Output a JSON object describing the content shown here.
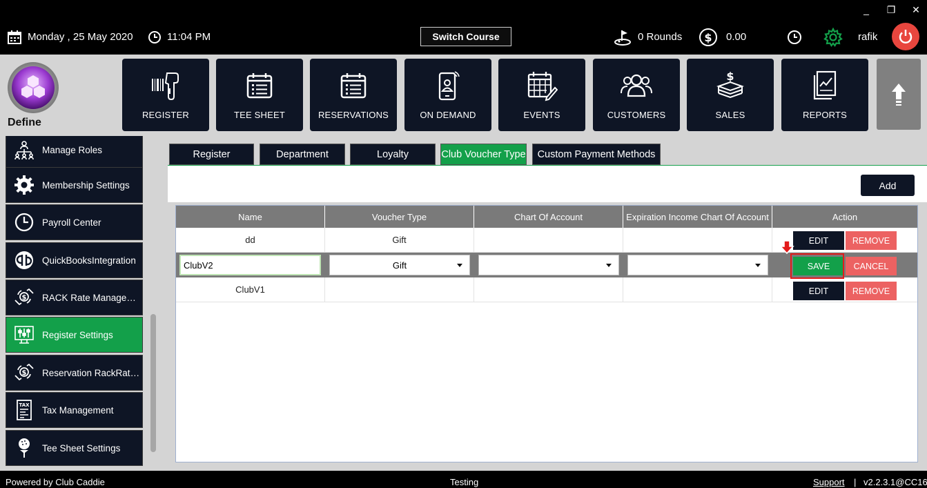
{
  "window": {
    "minimize": "_",
    "restore": "❐",
    "close": "✕"
  },
  "topbar": {
    "date": "Monday ,  25 May 2020",
    "time": "11:04 PM",
    "switch_course": "Switch Course",
    "rounds": "0 Rounds",
    "amount": "0.00",
    "username": "rafik"
  },
  "logo": {
    "label": "Define"
  },
  "nav": [
    {
      "label": "REGISTER",
      "icon": "barcode-scanner-icon"
    },
    {
      "label": "TEE SHEET",
      "icon": "calendar-list-icon"
    },
    {
      "label": "RESERVATIONS",
      "icon": "calendar-list-icon"
    },
    {
      "label": "ON DEMAND",
      "icon": "mobile-user-icon"
    },
    {
      "label": "EVENTS",
      "icon": "calendar-edit-icon"
    },
    {
      "label": "CUSTOMERS",
      "icon": "users-icon"
    },
    {
      "label": "SALES",
      "icon": "money-stack-icon"
    },
    {
      "label": "REPORTS",
      "icon": "report-chart-icon"
    }
  ],
  "sidebar": {
    "items": [
      {
        "label": "Manage Roles",
        "icon": "org-chart-icon"
      },
      {
        "label": "Membership Settings",
        "icon": "gear-icon"
      },
      {
        "label": "Payroll Center",
        "icon": "clock-icon"
      },
      {
        "label": "QuickBooksIntegration",
        "icon": "quickbooks-icon"
      },
      {
        "label": "RACK Rate Manageme...",
        "icon": "hand-money-icon"
      },
      {
        "label": "Register Settings",
        "icon": "register-settings-icon",
        "active": true
      },
      {
        "label": "Reservation RackRate...",
        "icon": "hand-money-icon"
      },
      {
        "label": "Tax Management",
        "icon": "tax-doc-icon"
      },
      {
        "label": "Tee Sheet Settings",
        "icon": "golf-ball-tee-icon"
      }
    ]
  },
  "tabs": [
    {
      "label": "Register"
    },
    {
      "label": "Department"
    },
    {
      "label": "Loyalty"
    },
    {
      "label": "Club Voucher Type",
      "active": true
    },
    {
      "label": "Custom Payment Methods"
    }
  ],
  "toolbar": {
    "add_label": "Add"
  },
  "grid": {
    "columns": [
      "Name",
      "Voucher Type",
      "Chart Of Account",
      "Expiration Income Chart Of Account",
      "Action"
    ],
    "rows": [
      {
        "name": "dd",
        "voucher_type": "Gift",
        "chart_of_account": "",
        "expiration_account": "",
        "edit": "EDIT",
        "remove": "REMOVE"
      },
      {
        "name": "ClubV1",
        "voucher_type": "",
        "chart_of_account": "",
        "expiration_account": "",
        "edit": "EDIT",
        "remove": "REMOVE"
      }
    ],
    "editing_row": {
      "name_value": "ClubV2",
      "voucher_type_value": "Gift",
      "chart_of_account_value": "",
      "expiration_value": "",
      "save": "SAVE",
      "cancel": "CANCEL"
    }
  },
  "footer": {
    "powered_by": "Powered by Club Caddie",
    "environment": "Testing",
    "support": "Support",
    "separator": "|",
    "version": "v2.2.3.1@CC16"
  },
  "colors": {
    "accent_green": "#13a04a",
    "dark_navy": "#0e1525",
    "power_red": "#e8463e",
    "remove_red": "#ec6262",
    "highlight_red": "#e31b1b"
  }
}
